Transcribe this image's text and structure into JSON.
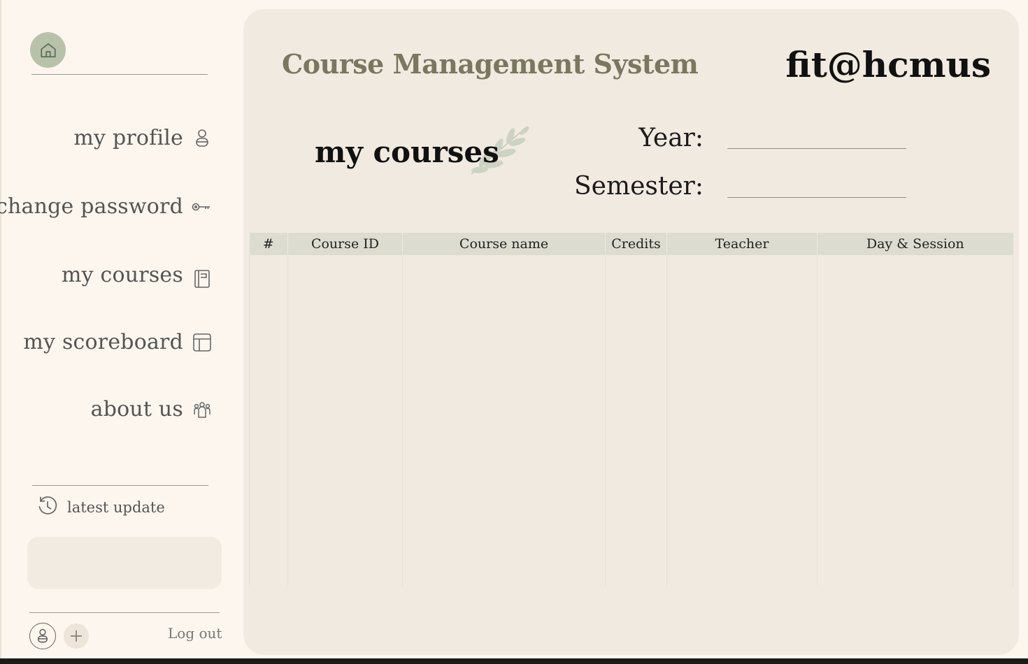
{
  "sidebar": {
    "nav": [
      {
        "label": "my profile",
        "icon": "user-icon"
      },
      {
        "label": "change password",
        "icon": "key-icon"
      },
      {
        "label": "my courses",
        "icon": "book-icon"
      },
      {
        "label": "my scoreboard",
        "icon": "layout-icon"
      },
      {
        "label": "about us",
        "icon": "people-icon"
      }
    ],
    "latest_update_label": "latest update",
    "logout_label": "Log out"
  },
  "header": {
    "app_title": "Course Management System",
    "brand": "fit@hcmus"
  },
  "page": {
    "title": "my courses",
    "year_label": "Year:",
    "year_value": "",
    "semester_label": "Semester:",
    "semester_value": ""
  },
  "table": {
    "columns": [
      "#",
      "Course ID",
      "Course name",
      "Credits",
      "Teacher",
      "Day & Session"
    ],
    "rows": []
  },
  "colors": {
    "background": "#fcf6ee",
    "panel": "#f1eae0",
    "accent_green": "#b8c2ab",
    "table_header": "#dcdcd0"
  }
}
